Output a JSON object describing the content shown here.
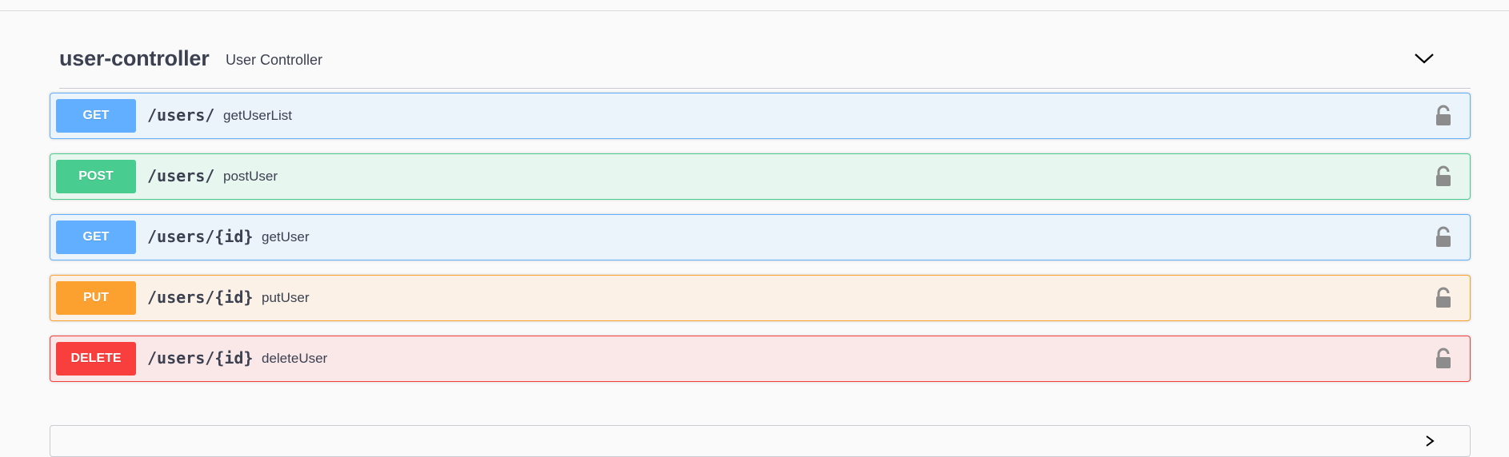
{
  "tag": {
    "name": "user-controller",
    "description": "User Controller",
    "toggle_icon": "chevron-down-icon"
  },
  "operations": [
    {
      "method": "GET",
      "path": "/users/",
      "summary": "getUserList",
      "color": "#61affe"
    },
    {
      "method": "POST",
      "path": "/users/",
      "summary": "postUser",
      "color": "#49cc90"
    },
    {
      "method": "GET",
      "path": "/users/{id}",
      "summary": "getUser",
      "color": "#61affe"
    },
    {
      "method": "PUT",
      "path": "/users/{id}",
      "summary": "putUser",
      "color": "#fca130"
    },
    {
      "method": "DELETE",
      "path": "/users/{id}",
      "summary": "deleteUser",
      "color": "#f93e3e"
    }
  ],
  "lock_icon": "unlocked-icon"
}
